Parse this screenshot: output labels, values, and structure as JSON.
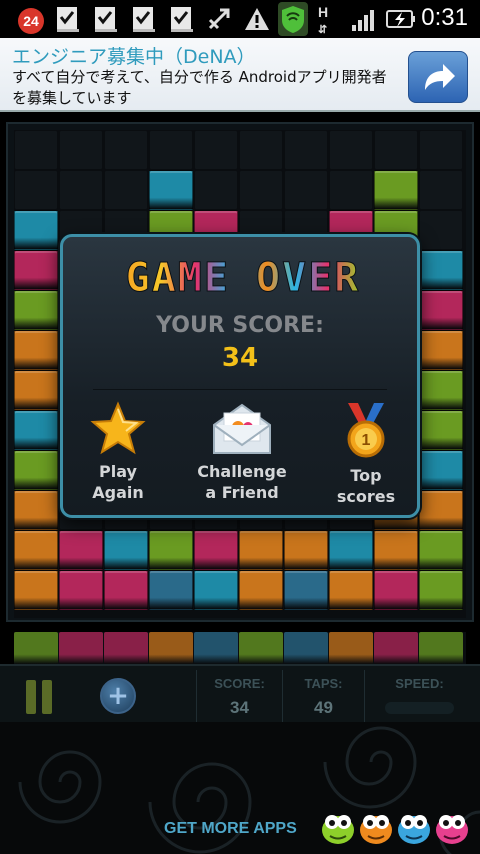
{
  "status_bar": {
    "notification_count": "24",
    "time": "0:31",
    "network_type": "H",
    "icons": [
      "download-complete-icon",
      "download-complete-icon",
      "download-complete-icon",
      "download-complete-icon",
      "usb-debug-icon",
      "warning-icon",
      "shield-icon",
      "data-arrows-icon",
      "signal-icon",
      "battery-charging-icon"
    ]
  },
  "ad": {
    "title": "エンジニア募集中（DeNA）",
    "body": "すべて自分で考えて、自分で作る Androidアプリ開発者を募集しています",
    "button_icon": "share-arrow-icon"
  },
  "dialog": {
    "title": "GAME OVER",
    "score_label": "YOUR SCORE:",
    "score_value": "34",
    "actions": [
      {
        "label": "Play\nAgain",
        "icon": "star-icon"
      },
      {
        "label": "Challenge\na Friend",
        "icon": "envelope-icon"
      },
      {
        "label": "Top\nscores",
        "icon": "medal-icon"
      }
    ]
  },
  "hud": {
    "score_label": "SCORE:",
    "score_value": "34",
    "taps_label": "TAPS:",
    "taps_value": "49",
    "speed_label": "SPEED:",
    "pause_icon": "pause-icon",
    "add_icon": "add-icon"
  },
  "footer": {
    "more_apps": "GET MORE APPS"
  },
  "colors": {
    "orange": "#c9751c",
    "cyan": "#1e8aa6",
    "pink": "#b3275b",
    "green": "#6a9b22",
    "blue": "#2a6a8a",
    "score_yellow": "#f3c019",
    "dialog_border": "#3d8fa7"
  },
  "board": {
    "columns": 10,
    "rows": 12,
    "cells": [
      "..........",
      "...C....G.",
      "C..GP..PG.",
      "PCCGG.POPC",
      "G.......GP",
      "O.......OO",
      "O.......PG",
      "C.......OG",
      "G.......GC",
      "O.......OO",
      "OPCGPOOCOG",
      "OPPBCOBOPG"
    ],
    "preview": "GPPOBGBOPG"
  }
}
